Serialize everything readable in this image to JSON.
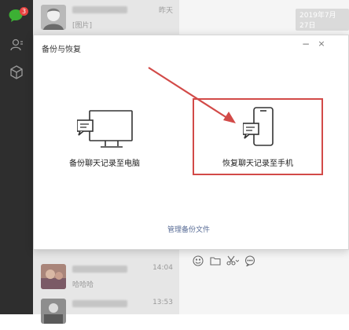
{
  "nav": {
    "badge": "3",
    "icons": [
      "chat-icon",
      "contacts-icon",
      "cube-icon"
    ]
  },
  "conversations": [
    {
      "time": "昨天",
      "preview": "[图片]"
    },
    {
      "time": "14:04",
      "preview": "哈哈哈"
    },
    {
      "time": "13:53",
      "preview": ""
    }
  ],
  "chat": {
    "date": "2019年7月27日"
  },
  "dialog": {
    "title": "备份与恢复",
    "minimize": "−",
    "close": "×",
    "backup_label": "备份聊天记录至电脑",
    "restore_label": "恢复聊天记录至手机",
    "manage_label": "管理备份文件"
  },
  "toolbar": {
    "icons": [
      "emoji-icon",
      "folder-icon",
      "scissors-icon",
      "bubble-icon"
    ]
  },
  "colors": {
    "sidebar": "#2e2e2e",
    "list": "#e6e6e6",
    "highlight": "#d24a48",
    "link": "#576b95",
    "wechat_green": "#3cb034"
  }
}
